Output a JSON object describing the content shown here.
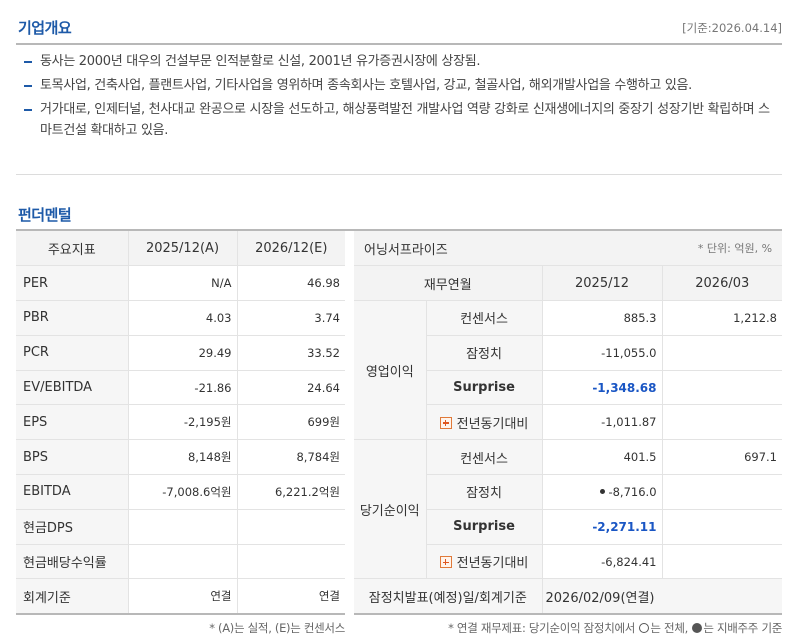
{
  "overview": {
    "title": "기업개요",
    "base_date": "[기준:2026.04.14]",
    "bullets": [
      "동사는 2000년 대우의 건설부문 인적분할로 신설, 2001년 유가증권시장에 상장됨.",
      "토목사업, 건축사업, 플랜트사업, 기타사업을 영위하며 종속회사는 호텔사업, 강교, 철골사업, 해외개발사업을 수행하고 있음.",
      "거가대로, 인제터널, 천사대교 완공으로 시장을 선도하고, 해상풍력발전 개발사업 역량 강화로 신재생에너지의 중장기 성장기반 확립하며 스마트건설 확대하고 있음."
    ]
  },
  "fundamental": {
    "title": "펀더멘털",
    "headers": [
      "주요지표",
      "2025/12(A)",
      "2026/12(E)"
    ],
    "rows": [
      {
        "label": "PER",
        "a": "N/A",
        "e": "46.98"
      },
      {
        "label": "PBR",
        "a": "4.03",
        "e": "3.74"
      },
      {
        "label": "PCR",
        "a": "29.49",
        "e": "33.52"
      },
      {
        "label": "EV/EBITDA",
        "a": "-21.86",
        "e": "24.64"
      },
      {
        "label": "EPS",
        "a": "-2,195원",
        "e": "699원"
      },
      {
        "label": "BPS",
        "a": "8,148원",
        "e": "8,784원"
      },
      {
        "label": "EBITDA",
        "a": "-7,008.6억원",
        "e": "6,221.2억원"
      },
      {
        "label": "현금DPS",
        "a": "",
        "e": ""
      },
      {
        "label": "현금배당수익률",
        "a": "",
        "e": ""
      },
      {
        "label": "회계기준",
        "a": "연결",
        "e": "연결"
      }
    ],
    "note": "* (A)는 실적, (E)는 컨센서스"
  },
  "earnings": {
    "title": "어닝서프라이즈",
    "unit": "* 단위: 억원, %",
    "headers": [
      "재무연월",
      "2025/12",
      "2026/03"
    ],
    "op_label": "영업이익",
    "net_label": "당기순이익",
    "op_rows": [
      {
        "label": "컨센서스",
        "v1": "885.3",
        "v2": "1,212.8"
      },
      {
        "label": "잠정치",
        "v1": "-11,055.0",
        "v2": ""
      },
      {
        "label": "Surprise",
        "v1": "-1,348.68",
        "v2": ""
      },
      {
        "label": "전년동기대비",
        "v1": "-1,011.87",
        "v2": ""
      }
    ],
    "net_rows": [
      {
        "label": "컨센서스",
        "v1": "401.5",
        "v2": "697.1"
      },
      {
        "label": "잠정치",
        "v1": "-8,716.0",
        "v2": ""
      },
      {
        "label": "Surprise",
        "v1": "-2,271.11",
        "v2": ""
      },
      {
        "label": "전년동기대비",
        "v1": "-6,824.41",
        "v2": ""
      }
    ],
    "footer_label": "잠정치발표(예정)일/회계기준",
    "footer_value": "2026/02/09(연결)",
    "note_part1": "* 연결 재무제표: 당기순이익 잠정치에서",
    "note_part2": "는 전체,",
    "note_part3": "는 지배주주 기준"
  }
}
